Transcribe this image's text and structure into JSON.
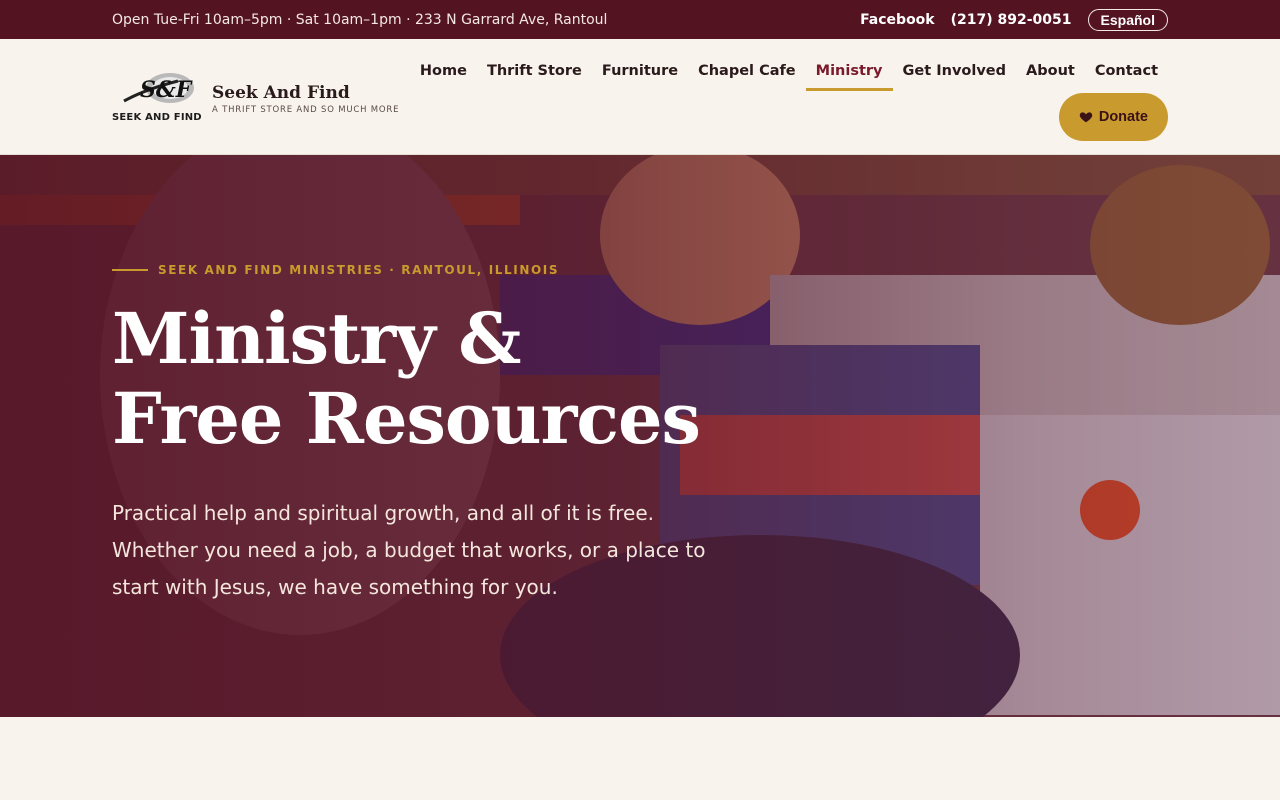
{
  "topbar": {
    "hours": "Open Tue-Fri 10am–5pm · Sat 10am–1pm · 233 N Garrard Ave, Rantoul",
    "facebook": "Facebook",
    "phone": "(217) 892-0051",
    "language": "Español"
  },
  "brand": {
    "logo_word": "SEEK AND FIND",
    "logo_mark": "S&F",
    "name": "Seek And Find",
    "tagline": "A THRIFT STORE AND SO MUCH MORE"
  },
  "nav": {
    "items": [
      {
        "label": "Home"
      },
      {
        "label": "Thrift Store"
      },
      {
        "label": "Furniture"
      },
      {
        "label": "Chapel Cafe"
      },
      {
        "label": "Ministry"
      },
      {
        "label": "Get Involved"
      },
      {
        "label": "About"
      },
      {
        "label": "Contact"
      }
    ],
    "active": "Ministry",
    "donate": "Donate",
    "donate_icon": "heart-icon"
  },
  "hero": {
    "eyebrow": "SEEK AND FIND MINISTRIES · RANTOUL, ILLINOIS",
    "title_line1": "Ministry &",
    "title_line2": "Free Resources",
    "description": "Practical help and spiritual growth, and all of it is free. Whether you need a job, a budget that works, or a place to start with Jesus, we have something for you."
  },
  "colors": {
    "maroon": "#541321",
    "gold": "#c99a2e",
    "cream": "#f8f3ec",
    "active_nav": "#7a1a2c"
  }
}
